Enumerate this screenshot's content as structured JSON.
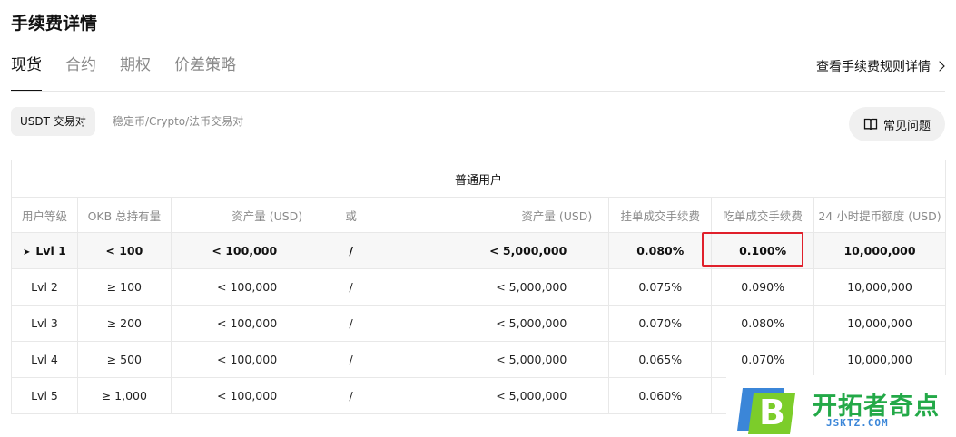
{
  "page_title": "手续费详情",
  "tabs": [
    {
      "label": "现货",
      "active": true
    },
    {
      "label": "合约",
      "active": false
    },
    {
      "label": "期权",
      "active": false
    },
    {
      "label": "价差策略",
      "active": false
    }
  ],
  "fee_rules_link": "查看手续费规则详情",
  "subtabs": {
    "active": "USDT 交易对",
    "other": "稳定币/Crypto/法币交易对"
  },
  "faq_button": "常见问题",
  "table": {
    "group_header": "普通用户",
    "columns": {
      "level": "用户等级",
      "okb": "OKB 总持有量",
      "assets1": "资产量 (USD)",
      "or": "或",
      "assets2": "资产量 (USD)",
      "maker": "挂单成交手续费",
      "taker": "吃单成交手续费",
      "withdraw": "24 小时提币额度 (USD)"
    },
    "rows": [
      {
        "level": "Lvl 1",
        "okb": "< 100",
        "assets1": "< 100,000",
        "or": "/",
        "assets2": "< 5,000,000",
        "maker": "0.080%",
        "taker": "0.100%",
        "withdraw": "10,000,000",
        "current": true
      },
      {
        "level": "Lvl 2",
        "okb": "≥ 100",
        "assets1": "< 100,000",
        "or": "/",
        "assets2": "< 5,000,000",
        "maker": "0.075%",
        "taker": "0.090%",
        "withdraw": "10,000,000"
      },
      {
        "level": "Lvl 3",
        "okb": "≥ 200",
        "assets1": "< 100,000",
        "or": "/",
        "assets2": "< 5,000,000",
        "maker": "0.070%",
        "taker": "0.080%",
        "withdraw": "10,000,000"
      },
      {
        "level": "Lvl 4",
        "okb": "≥ 500",
        "assets1": "< 100,000",
        "or": "/",
        "assets2": "< 5,000,000",
        "maker": "0.065%",
        "taker": "0.070%",
        "withdraw": "10,000,000"
      },
      {
        "level": "Lvl 5",
        "okb": "≥ 1,000",
        "assets1": "< 100,000",
        "or": "/",
        "assets2": "< 5,000,000",
        "maker": "0.060%",
        "taker": "",
        "withdraw": ""
      }
    ]
  },
  "highlight_color": "#e0202b",
  "watermark": {
    "logo_letter": "B",
    "name": "开拓者奇点",
    "domain": "JSKTZ.COM"
  },
  "icons": {
    "faq": "book-icon",
    "chevron": "chevron-right-icon",
    "current_level": "play-marker-icon"
  }
}
